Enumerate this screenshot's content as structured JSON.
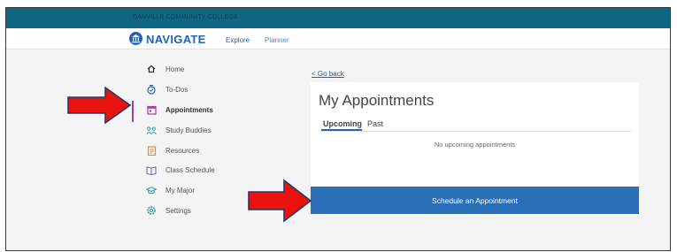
{
  "header": {
    "college_name": "DANVILLE COMMUNITY COLLEGE"
  },
  "navbar": {
    "brand": "NAVIGATE",
    "links": [
      "Explore",
      "Planner"
    ]
  },
  "sidebar": {
    "items": [
      {
        "label": "Home",
        "icon": "home-icon"
      },
      {
        "label": "To-Dos",
        "icon": "todos-icon"
      },
      {
        "label": "Appointments",
        "icon": "calendar-icon",
        "active": true
      },
      {
        "label": "Study Buddies",
        "icon": "people-icon"
      },
      {
        "label": "Resources",
        "icon": "document-icon"
      },
      {
        "label": "Class Schedule",
        "icon": "book-icon"
      },
      {
        "label": "My Major",
        "icon": "graduation-cap-icon"
      },
      {
        "label": "Settings",
        "icon": "gear-icon"
      }
    ]
  },
  "main": {
    "back_link": "< Go back",
    "title": "My Appointments",
    "tabs": [
      {
        "label": "Upcoming",
        "active": true
      },
      {
        "label": "Past"
      }
    ],
    "empty_message": "No upcoming appointments",
    "schedule_button": "Schedule an Appointment"
  },
  "colors": {
    "topbar": "#0f6682",
    "brand_blue": "#2463b3",
    "button_blue": "#2a6fb8",
    "active_bar": "#9e3fa6",
    "arrow_red": "#e8120f"
  }
}
